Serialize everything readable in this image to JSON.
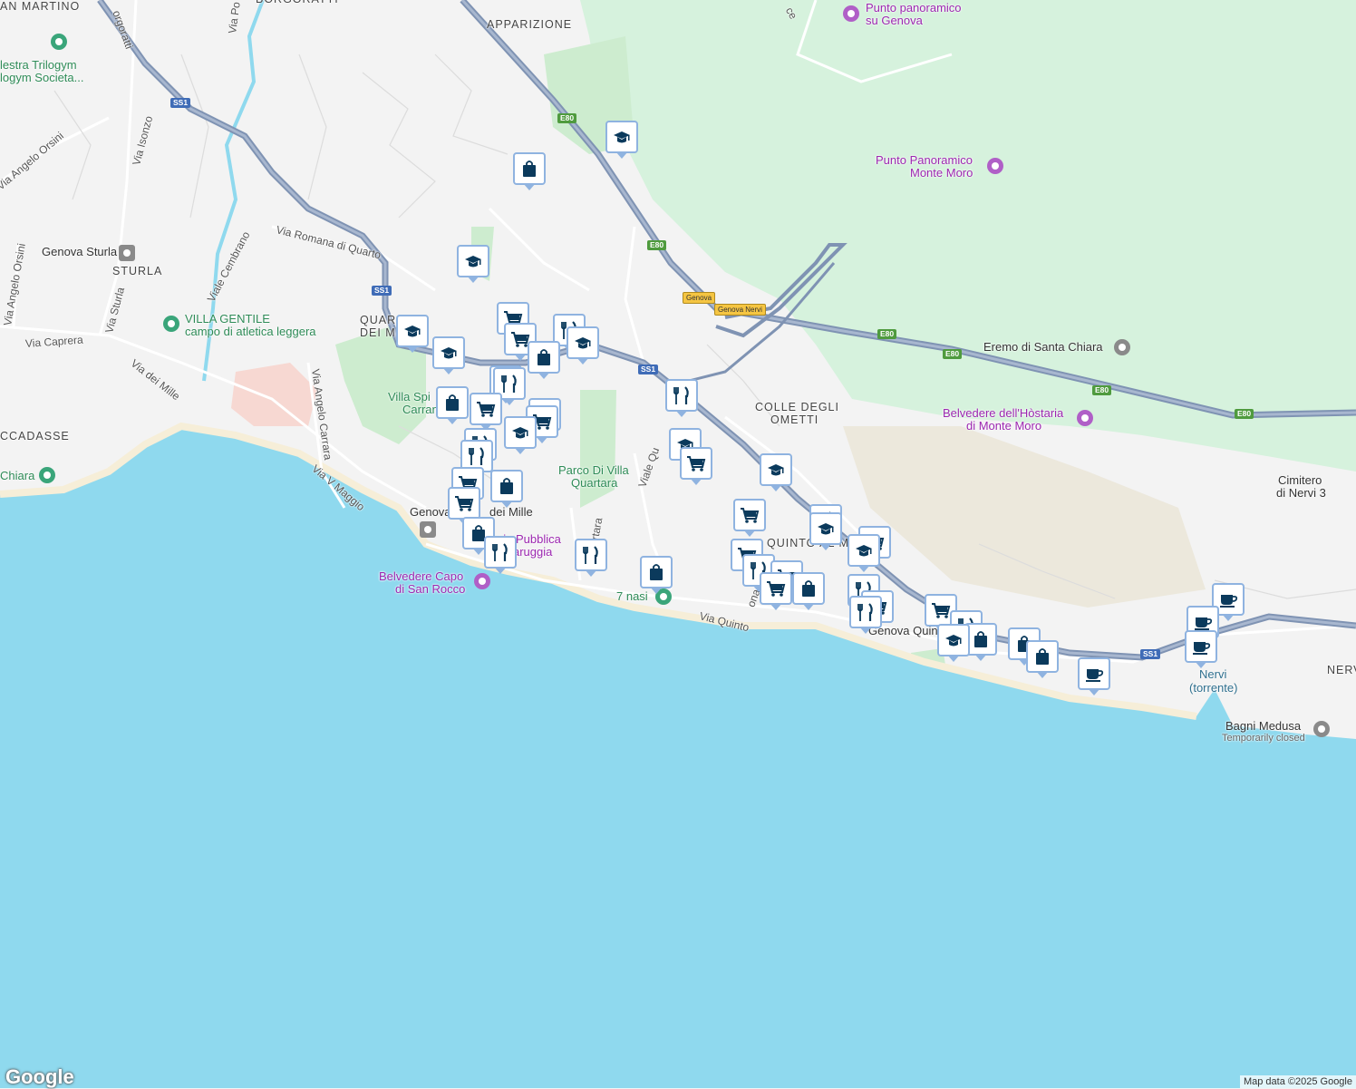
{
  "map": {
    "colors": {
      "sea": "#8fd9ee",
      "land": "#f3f3f3",
      "park": "#cdeccf",
      "green_hill": "#d6f2dd",
      "highway": "#7f93b3",
      "pin_icon": "#0b3a5c"
    },
    "areas": [
      "APPARIZIONE",
      "SAN MARTINO",
      "BORGORATTI",
      "STURLA",
      "QUARTO DEI MILLE",
      "COLLE DEGLI OMETTI",
      "QUINTO AL MARE",
      "NERVI",
      "VERNAZZOLA/BOCCADASSE"
    ],
    "area_labels": {
      "apparizione": "APPARIZIONE",
      "san_martino": "AN MARTINO",
      "borgoratti": "BORGORATTI",
      "sturla": "STURLA",
      "quarto_1": "QUAR",
      "quarto_2": "DEI MI",
      "colle_1": "COLLE DEGLI",
      "colle_2": "OMETTI",
      "quinto": "QUINTO AL M",
      "nervi": "NERV",
      "boccadasse": "CCADASSE"
    },
    "roads": {
      "via_isonzo": "Via Isonzo",
      "via_angelo_orsini": "Via Angelo Orsini",
      "via_angelo_orsini_2": "Via Angelo Orsini",
      "via_sturla": "Via Sturla",
      "viale_cembrano": "Viale Cembrano",
      "via_romana_di_quarto": "Via Romana di Quarto",
      "via_caprera": "Via Caprera",
      "via_dei_mille": "Via dei Mille",
      "via_angelo_carrara": "Via Angelo Carrara",
      "via_v_maggio": "Via V Maggio",
      "via_quinto": "Via Quinto",
      "viale_quartara": "Viale Qu",
      "via_quartara": "artara",
      "via_bo": "Via Po",
      "borgoratti_rd": "orgoratti",
      "via_pr": "ce",
      "via_quinto_2": "ona"
    },
    "shields": {
      "ss1_a": "SS1",
      "ss1_b": "SS1",
      "ss1_c": "SS1",
      "ss1_d": "SS1",
      "e80_a": "E80",
      "e80_b": "E80",
      "e80_c": "E80",
      "e80_d": "E80",
      "e80_e": "E80",
      "e80_f": "E80",
      "genova": "Genova",
      "genova_nervi": "Genova Nervi"
    },
    "places": {
      "palestra_1": "lestra Trilogym",
      "palestra_2": "logym Societa...",
      "genova_sturla": "Genova Sturla",
      "villa_gentile_1": "VILLA GENTILE",
      "villa_gentile_2": "campo di atletica leggera",
      "villa_spinola_1": "Villa Spi",
      "villa_spinola_2": "Carran",
      "parco_quartara_1": "Parco Di Villa",
      "parco_quartara_2": "Quartara",
      "genova_quarto_1": "Genova",
      "genova_quarto_2": "dei Mille",
      "spiaggia_1": "gia Pubblica",
      "spiaggia_2": "aruggia",
      "belvedere_capo_1": "Belvedere Capo",
      "belvedere_capo_2": "di San Rocco",
      "sette_nasi": "7 nasi",
      "chiara": "Chiara",
      "punto_genova_1": "Punto panoramico",
      "punto_genova_2": "su Genova",
      "punto_moro_1": "Punto Panoramico",
      "punto_moro_2": "Monte Moro",
      "eremo": "Eremo di Santa Chiara",
      "belvedere_hostaria_1": "Belvedere dell'Hòstaria",
      "belvedere_hostaria_2": "di Monte Moro",
      "cimitero_1": "Cimitero",
      "cimitero_2": "di Nervi 3",
      "genova_quinto": "Genova Quinto",
      "nervi_torrente_1": "Nervi",
      "nervi_torrente_2": "(torrente)",
      "bagni_medusa": "Bagni Medusa",
      "bagni_status": "Temporarily closed"
    },
    "pin_icons": [
      "graduation-cap-icon",
      "shopping-bag-icon",
      "shopping-cart-icon",
      "fork-knife-icon",
      "coffee-cup-icon"
    ],
    "attribution": "Map data ©2025 Google",
    "logo": "Google"
  }
}
